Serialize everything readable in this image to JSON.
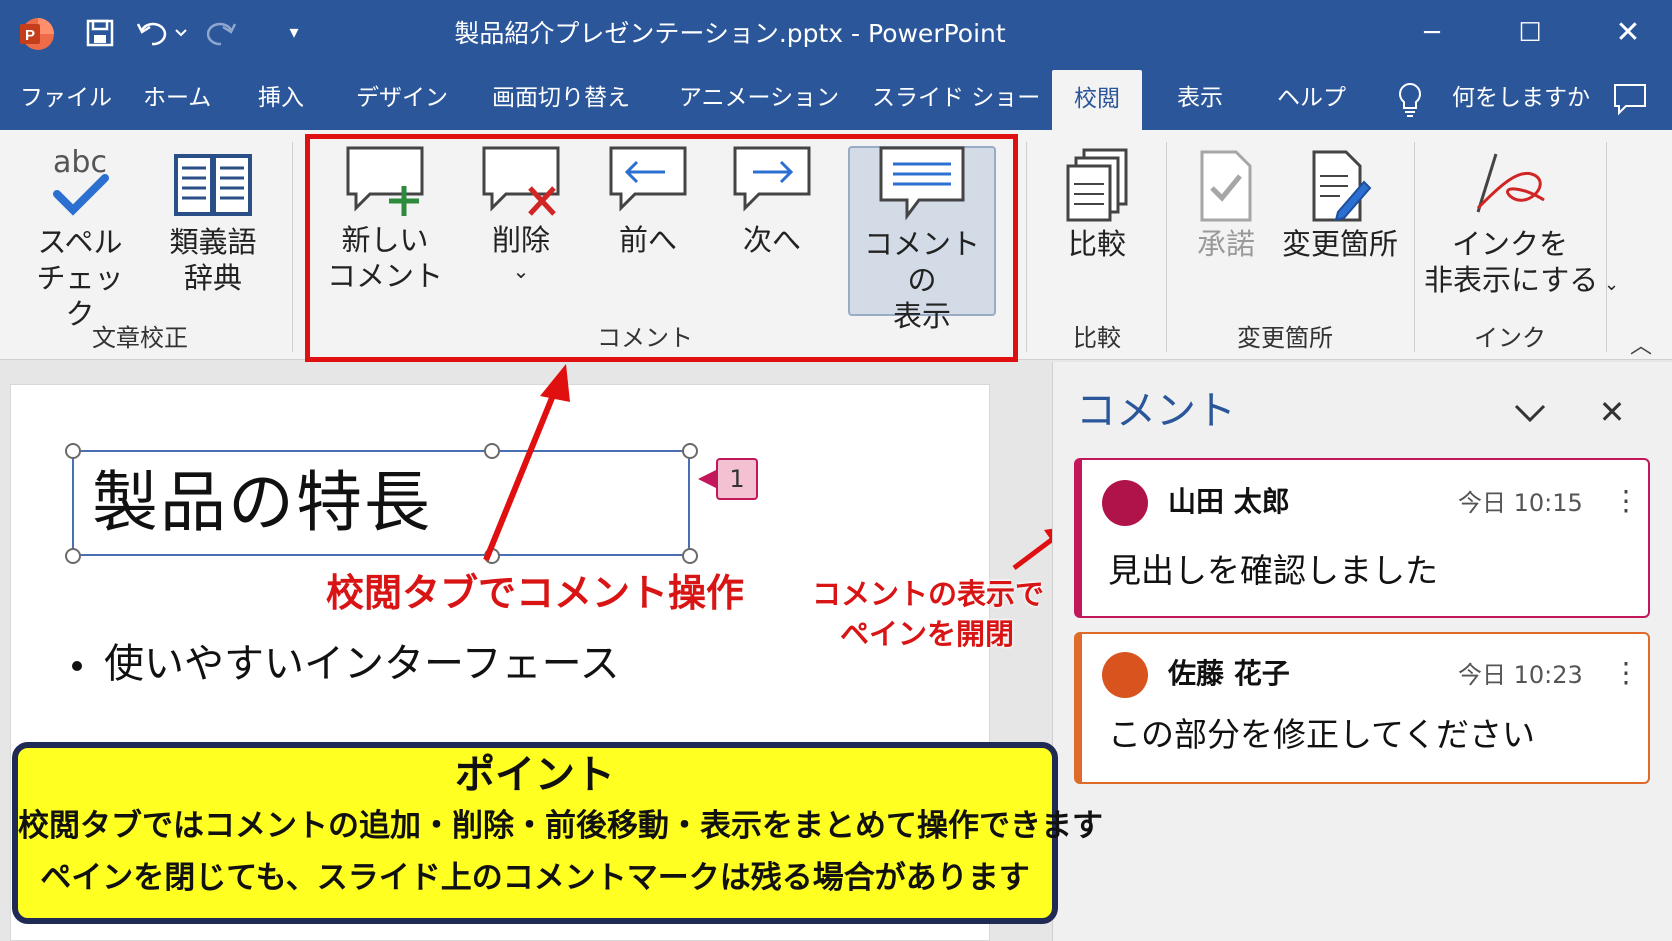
{
  "app": {
    "window_title": "製品紹介プレゼンテーション.pptx  -  PowerPoint",
    "quick_access": [
      "save-icon",
      "undo-icon",
      "redo-icon",
      "customize-icon"
    ],
    "window_controls": [
      "minimize-icon",
      "maximize-icon",
      "close-icon"
    ],
    "accent": "#2b579a"
  },
  "tabs": {
    "items": [
      "ファイル",
      "ホーム",
      "挿入",
      "デザイン",
      "画面切り替え",
      "アニメーション",
      "スライド ショー",
      "校閲",
      "表示",
      "ヘルプ"
    ],
    "active": "校閲",
    "tell_me": "何をしますか"
  },
  "ribbon": {
    "proofing": {
      "spell": [
        "スペル",
        "チェック"
      ],
      "thesaurus": [
        "類義語",
        "辞典"
      ],
      "group_label": "文章校正"
    },
    "comments": {
      "new": [
        "新しい",
        "コメント"
      ],
      "delete": "削除",
      "prev": "前へ",
      "next": "次へ",
      "show": [
        "コメントの",
        "表示"
      ],
      "group_label": "コメント"
    },
    "compare": {
      "compare": "比較",
      "group_label": "比較"
    },
    "changes": {
      "accept": "承諾",
      "changes": "変更箇所",
      "group_label": "変更箇所"
    },
    "ink": {
      "hide": [
        "インクを",
        "非表示にする"
      ],
      "group_label": "インク"
    }
  },
  "slide": {
    "title": "製品の特長",
    "bullet": "使いやすいインターフェース",
    "comment_marker": "1"
  },
  "annotations": {
    "review_tab": "校閲タブでコメント操作",
    "pane_note": [
      "コメントの表示で",
      "ペインを開閉"
    ],
    "point_title": "ポイント",
    "point_lines": [
      "校閲タブではコメントの追加・削除・前後移動・表示をまとめて操作できます",
      "ペインを閉じても、スライド上のコメントマークは残る場合があります"
    ],
    "highlight_color": "#e11010",
    "point_bg": "#ffff22"
  },
  "comment_pane": {
    "title": "コメント",
    "comments": [
      {
        "author": "山田 太郎",
        "time": "今日 10:15",
        "text": "見出しを確認しました",
        "color": "#b0134a"
      },
      {
        "author": "佐藤 花子",
        "time": "今日 10:23",
        "text": "この部分を修正してください",
        "color": "#d9531e"
      }
    ]
  }
}
